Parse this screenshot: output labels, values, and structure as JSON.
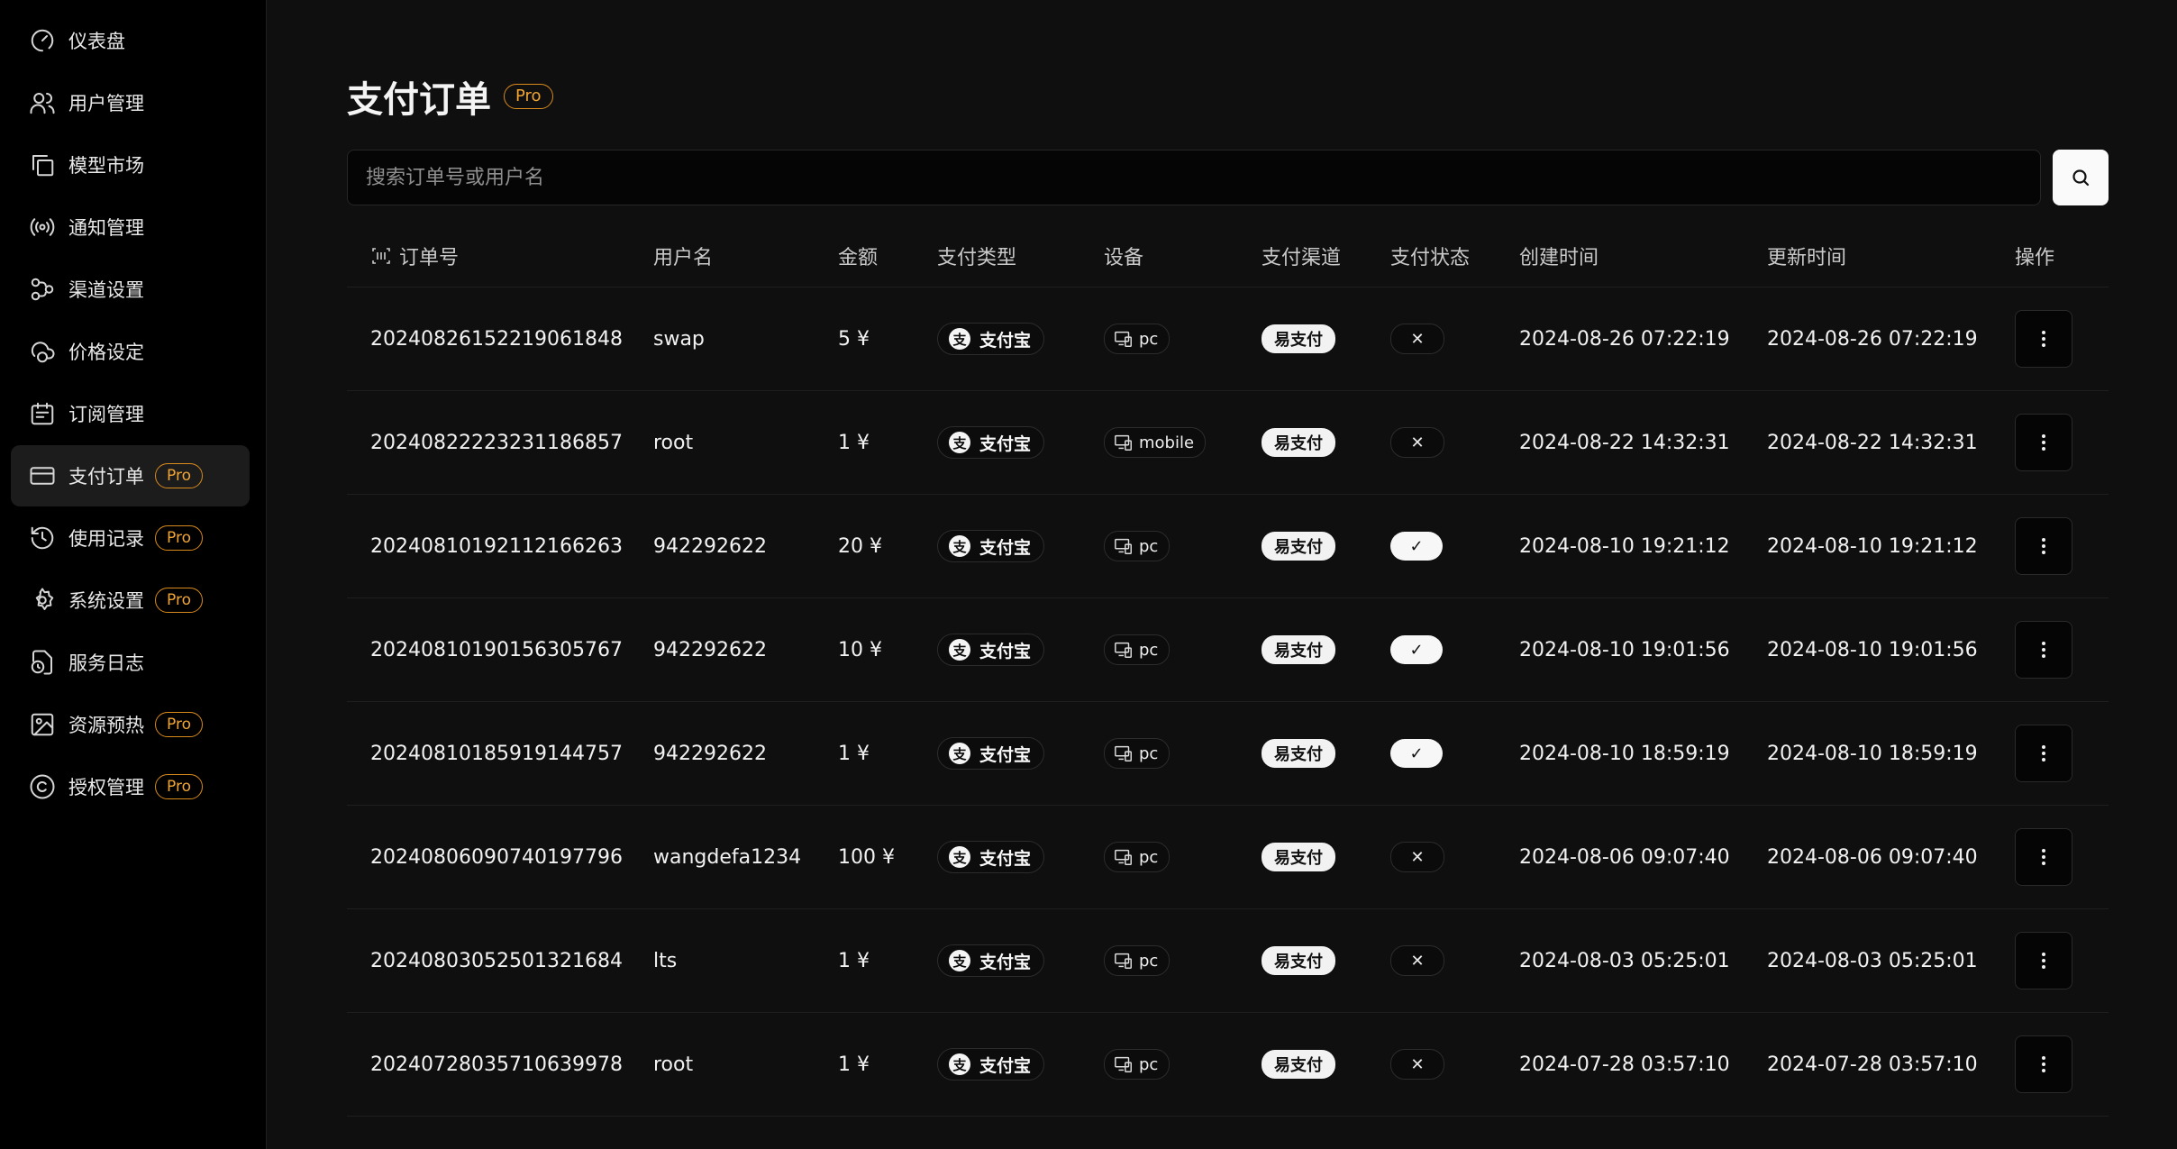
{
  "sidebar": {
    "items": [
      {
        "label": "仪表盘",
        "icon": "gauge-icon",
        "pro": false,
        "active": false
      },
      {
        "label": "用户管理",
        "icon": "users-icon",
        "pro": false,
        "active": false
      },
      {
        "label": "模型市场",
        "icon": "copy-icon",
        "pro": false,
        "active": false
      },
      {
        "label": "通知管理",
        "icon": "broadcast-icon",
        "pro": false,
        "active": false
      },
      {
        "label": "渠道设置",
        "icon": "workflow-icon",
        "pro": false,
        "active": false
      },
      {
        "label": "价格设定",
        "icon": "cloud-coin-icon",
        "pro": false,
        "active": false
      },
      {
        "label": "订阅管理",
        "icon": "calendar-icon",
        "pro": false,
        "active": false
      },
      {
        "label": "支付订单",
        "icon": "credit-card-icon",
        "pro": true,
        "active": true
      },
      {
        "label": "使用记录",
        "icon": "history-icon",
        "pro": true,
        "active": false
      },
      {
        "label": "系统设置",
        "icon": "settings-icon",
        "pro": true,
        "active": false
      },
      {
        "label": "服务日志",
        "icon": "file-clock-icon",
        "pro": false,
        "active": false
      },
      {
        "label": "资源预热",
        "icon": "image-preload-icon",
        "pro": true,
        "active": false
      },
      {
        "label": "授权管理",
        "icon": "copyright-icon",
        "pro": true,
        "active": false
      }
    ],
    "pro_label": "Pro"
  },
  "header": {
    "title": "支付订单",
    "pro_label": "Pro"
  },
  "search": {
    "placeholder": "搜索订单号或用户名",
    "value": ""
  },
  "colors": {
    "accent": "#f0a534",
    "background": "#0f0f10",
    "sidebar": "#000000"
  },
  "table": {
    "headers": {
      "order_id": "订单号",
      "username": "用户名",
      "amount": "金额",
      "pay_type": "支付类型",
      "device": "设备",
      "channel": "支付渠道",
      "status": "支付状态",
      "created": "创建时间",
      "updated": "更新时间",
      "actions": "操作"
    },
    "rows": [
      {
        "order_id": "20240826152219061848",
        "username": "swap",
        "amount": "5 ¥",
        "pay_type": "支付宝",
        "device": "pc",
        "channel": "易支付",
        "status": "x",
        "created": "2024-08-26 07:22:19",
        "updated": "2024-08-26 07:22:19"
      },
      {
        "order_id": "20240822223231186857",
        "username": "root",
        "amount": "1 ¥",
        "pay_type": "支付宝",
        "device": "mobile",
        "channel": "易支付",
        "status": "x",
        "created": "2024-08-22 14:32:31",
        "updated": "2024-08-22 14:32:31"
      },
      {
        "order_id": "20240810192112166263",
        "username": "942292622",
        "amount": "20 ¥",
        "pay_type": "支付宝",
        "device": "pc",
        "channel": "易支付",
        "status": "ok",
        "created": "2024-08-10 19:21:12",
        "updated": "2024-08-10 19:21:12"
      },
      {
        "order_id": "20240810190156305767",
        "username": "942292622",
        "amount": "10 ¥",
        "pay_type": "支付宝",
        "device": "pc",
        "channel": "易支付",
        "status": "ok",
        "created": "2024-08-10 19:01:56",
        "updated": "2024-08-10 19:01:56"
      },
      {
        "order_id": "20240810185919144757",
        "username": "942292622",
        "amount": "1 ¥",
        "pay_type": "支付宝",
        "device": "pc",
        "channel": "易支付",
        "status": "ok",
        "created": "2024-08-10 18:59:19",
        "updated": "2024-08-10 18:59:19"
      },
      {
        "order_id": "20240806090740197796",
        "username": "wangdefa1234",
        "amount": "100 ¥",
        "pay_type": "支付宝",
        "device": "pc",
        "channel": "易支付",
        "status": "x",
        "created": "2024-08-06 09:07:40",
        "updated": "2024-08-06 09:07:40"
      },
      {
        "order_id": "20240803052501321684",
        "username": "lts",
        "amount": "1 ¥",
        "pay_type": "支付宝",
        "device": "pc",
        "channel": "易支付",
        "status": "x",
        "created": "2024-08-03 05:25:01",
        "updated": "2024-08-03 05:25:01"
      },
      {
        "order_id": "20240728035710639978",
        "username": "root",
        "amount": "1 ¥",
        "pay_type": "支付宝",
        "device": "pc",
        "channel": "易支付",
        "status": "x",
        "created": "2024-07-28 03:57:10",
        "updated": "2024-07-28 03:57:10"
      }
    ]
  }
}
